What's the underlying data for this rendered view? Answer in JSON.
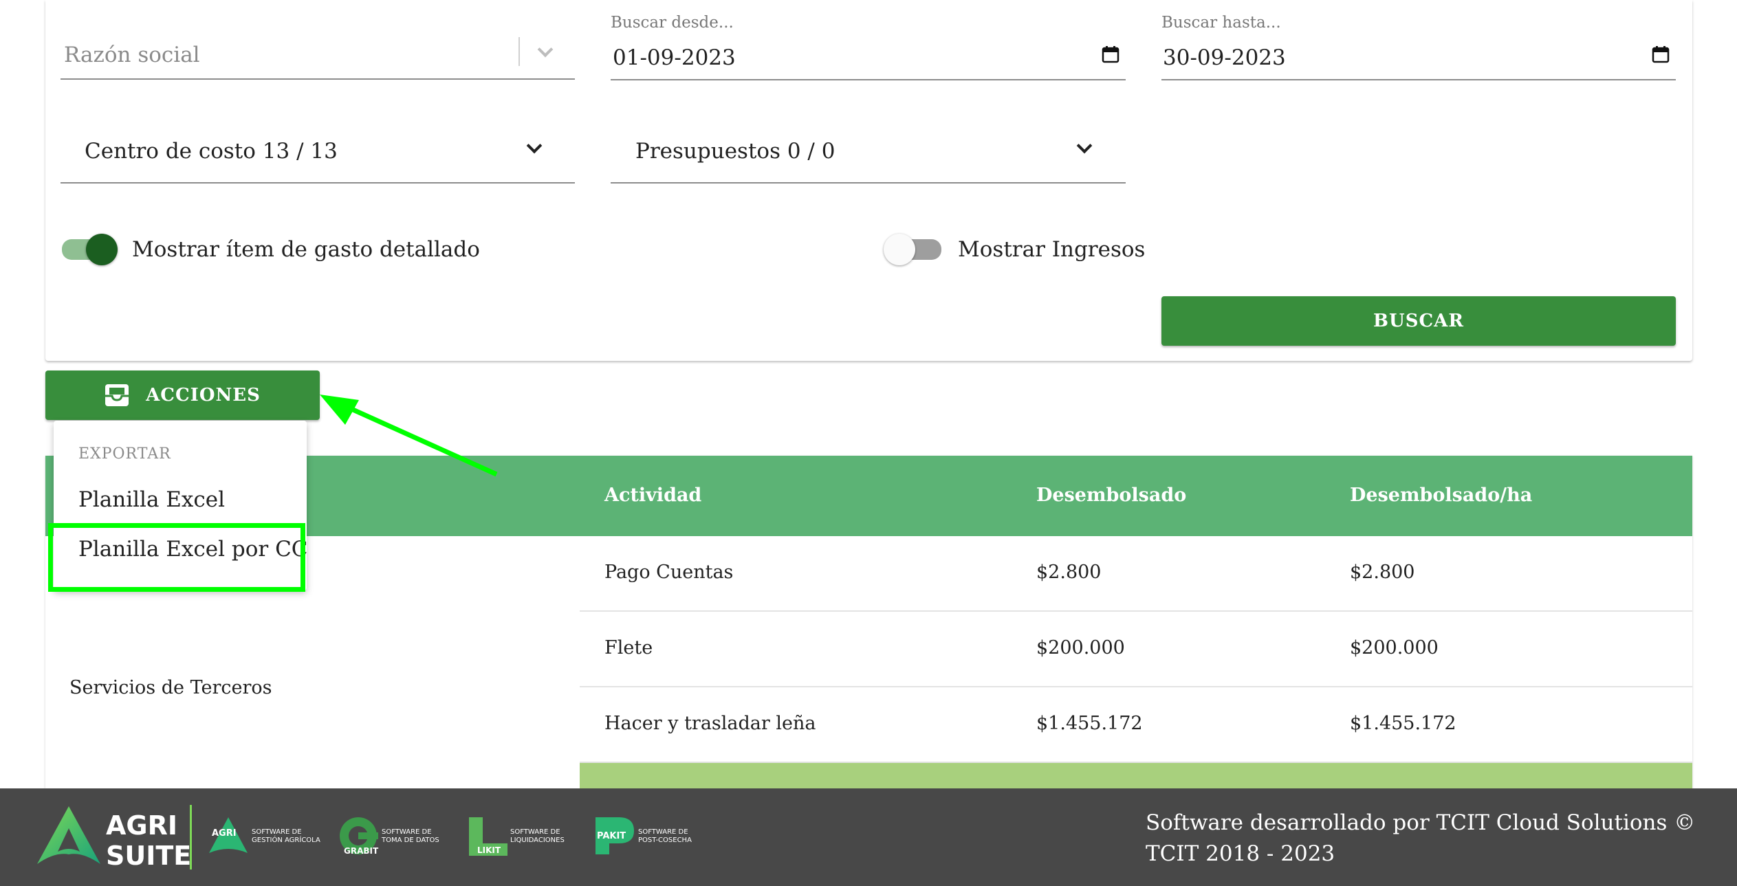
{
  "filters": {
    "razon_social_placeholder": "Razón social",
    "buscar_desde_label": "Buscar desde...",
    "buscar_desde_value": "01-09-2023",
    "buscar_hasta_label": "Buscar hasta...",
    "buscar_hasta_value": "30-09-2023",
    "centro_costo": "Centro de costo 13 / 13",
    "presupuestos": "Presupuestos 0 / 0",
    "toggle_detalle_label": "Mostrar ítem de gasto detallado",
    "toggle_detalle_on": true,
    "toggle_ingresos_label": "Mostrar Ingresos",
    "toggle_ingresos_on": false,
    "buscar_button": "BUSCAR"
  },
  "actions": {
    "button_label": "ACCIONES",
    "icon": "inbox-tray-icon",
    "menu": {
      "header": "EXPORTAR",
      "items": [
        "Planilla Excel",
        "Planilla Excel por CC"
      ]
    }
  },
  "table": {
    "headers": [
      "Actividad",
      "Desembolsado",
      "Desembolsado/ha"
    ],
    "group": "Servicios de Terceros",
    "rows": [
      {
        "actividad": "Pago Cuentas",
        "desembolsado": "$2.800",
        "desembolsado_ha": "$2.800"
      },
      {
        "actividad": "Flete",
        "desembolsado": "$200.000",
        "desembolsado_ha": "$200.000"
      },
      {
        "actividad": "Hacer y trasladar leña",
        "desembolsado": "$1.455.172",
        "desembolsado_ha": "$1.455.172"
      }
    ]
  },
  "footer": {
    "brand_main_line1": "AGRI",
    "brand_main_line2": "SUITE",
    "products": [
      {
        "name": "AGRI",
        "line1": "SOFTWARE DE",
        "line2": "GESTIÓN AGRÍCOLA"
      },
      {
        "name": "GRABIT",
        "line1": "SOFTWARE DE",
        "line2": "TOMA DE DATOS"
      },
      {
        "name": "LIKIT",
        "line1": "SOFTWARE DE",
        "line2": "LIQUIDACIONES"
      },
      {
        "name": "PAKIT",
        "line1": "SOFTWARE DE",
        "line2": "POST-COSECHA"
      }
    ],
    "copyright": "Software desarrollado por TCIT Cloud Solutions © TCIT 2018 - 2023"
  },
  "colors": {
    "primary_green": "#388e3c",
    "header_green": "#5cb375",
    "total_green": "#a8d07d",
    "highlight": "#00ff00",
    "footer_bg": "#484848"
  }
}
